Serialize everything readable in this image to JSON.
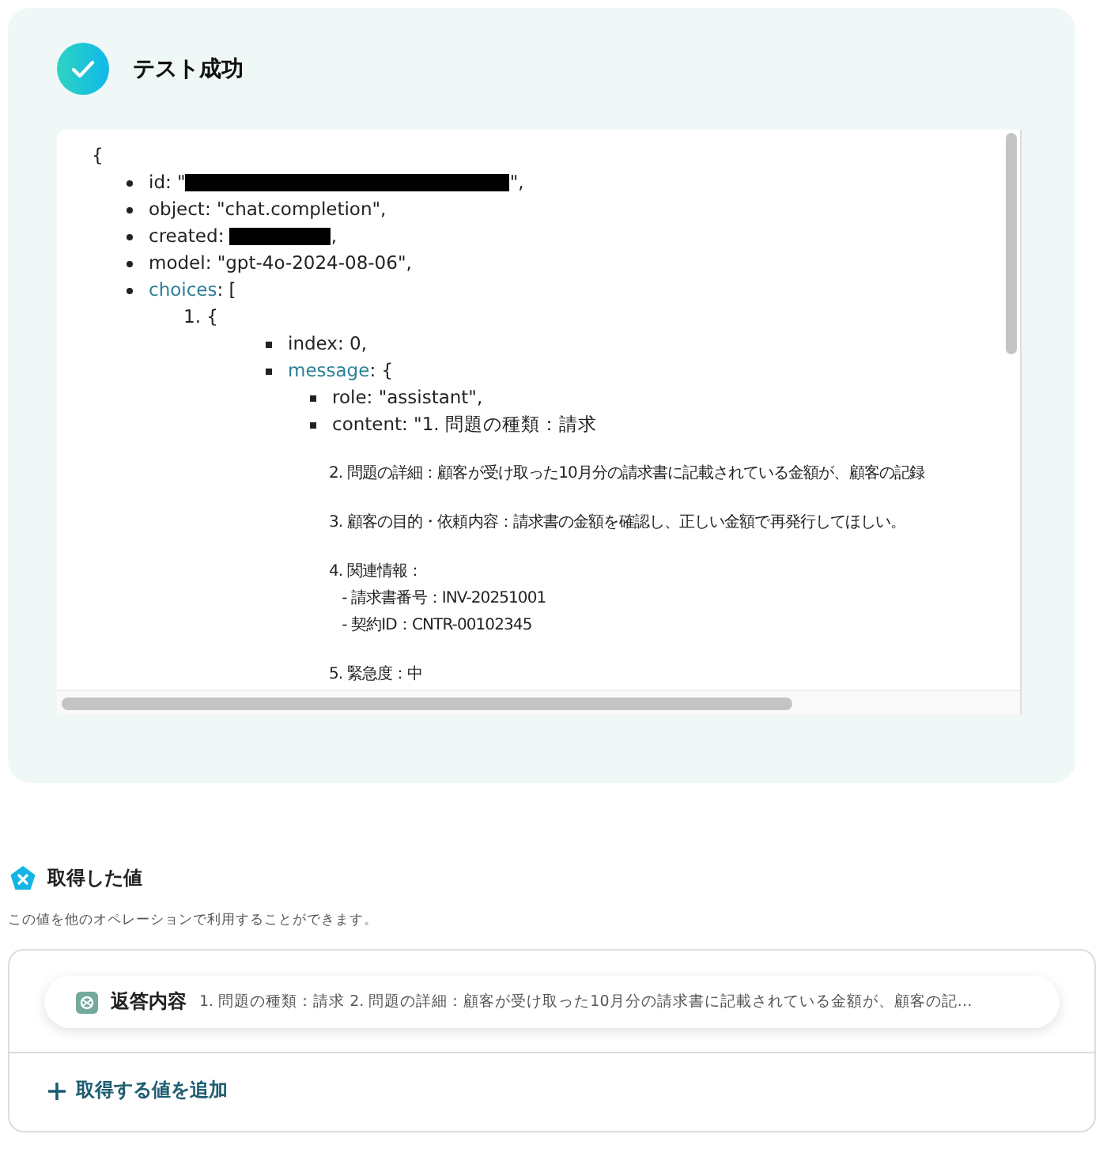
{
  "result": {
    "title": "テスト成功",
    "open": "{",
    "items": [
      {
        "key": "id",
        "linked": false,
        "before": ": \"",
        "redacted": true,
        "after": "\","
      },
      {
        "key": "object",
        "linked": false,
        "before": ": \"chat.completion\","
      },
      {
        "key": "created",
        "linked": false,
        "before": ": ",
        "redacted": true,
        "after": ","
      },
      {
        "key": "model",
        "linked": false,
        "before": ": \"gpt-4o-2024-08-06\","
      },
      {
        "key": "choices",
        "linked": true,
        "before": ": [",
        "children": [
          {
            "number": "1.",
            "text": "{",
            "children": [
              {
                "key": "index",
                "linked": false,
                "before": ": 0,"
              },
              {
                "key": "message",
                "linked": true,
                "before": ": {",
                "children": [
                  {
                    "key": "role",
                    "linked": false,
                    "before": ": \"assistant\","
                  },
                  {
                    "key": "content",
                    "linked": false,
                    "before": ": \"1. 問題の種類：請求",
                    "paragraphs": [
                      [
                        "2. 問題の詳細：顧客が受け取った10月分の請求書に記載されている金額が、顧客の記録"
                      ],
                      [
                        "3. 顧客の目的・依頼内容：請求書の金額を確認し、正しい金額で再発行してほしい。"
                      ],
                      [
                        "4. 関連情報：",
                        "   - 請求書番号：INV-20251001",
                        "   - 契約ID：CNTR-00102345"
                      ],
                      [
                        "5. 緊急度：中"
                      ]
                    ]
                  }
                ]
              }
            ]
          }
        ]
      }
    ]
  },
  "values": {
    "title": "取得した値",
    "description": "この値を他のオペレーションで利用することができます。",
    "items": [
      {
        "label": "返答内容",
        "value": "1. 問題の種類：請求 2. 問題の詳細：顧客が受け取った10月分の請求書に記載されている金額が、顧客の記…"
      }
    ],
    "add_button": "取得する値を追加"
  }
}
